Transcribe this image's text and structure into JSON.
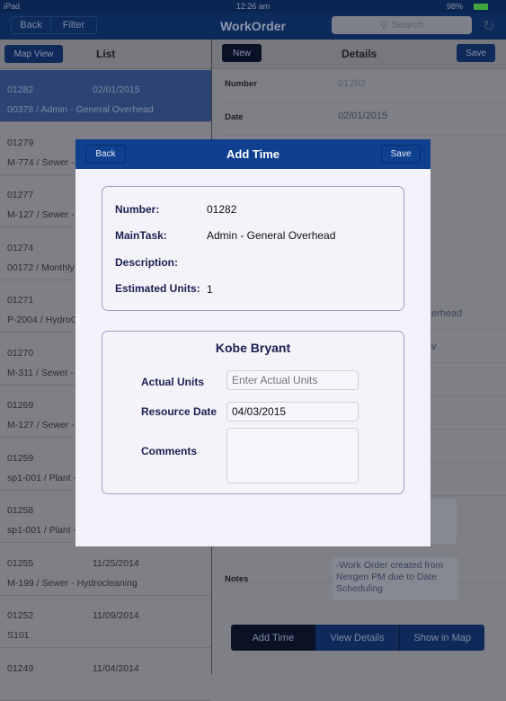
{
  "status": {
    "device": "iPad",
    "time": "12:26 am",
    "battery": "98%"
  },
  "nav": {
    "back": "Back",
    "filter": "Filter",
    "title": "WorkOrder",
    "search_placeholder": "Search"
  },
  "list_header": {
    "map_view": "Map View",
    "title": "List"
  },
  "list": [
    {
      "number": "01282",
      "date": "02/01/2015",
      "subtitle": "00378 / Admin - General Overhead",
      "selected": true
    },
    {
      "number": "01279",
      "date": "",
      "subtitle": "M-774 / Sewer -"
    },
    {
      "number": "01277",
      "date": "",
      "subtitle": "M-127 / Sewer -"
    },
    {
      "number": "01274",
      "date": "",
      "subtitle": "00172 /  Monthly"
    },
    {
      "number": "01271",
      "date": "",
      "subtitle": "P-2004 /  HydroC"
    },
    {
      "number": "01270",
      "date": "",
      "subtitle": "M-311 / Sewer -"
    },
    {
      "number": "01269",
      "date": "",
      "subtitle": "M-127 / Sewer -"
    },
    {
      "number": "01259",
      "date": "",
      "subtitle": "sp1-001 / Plant -"
    },
    {
      "number": "01258",
      "date": "",
      "subtitle": "sp1-001 / Plant -"
    },
    {
      "number": "01255",
      "date": "11/25/2014",
      "subtitle": "M-199 / Sewer - Hydrocleaning"
    },
    {
      "number": "01252",
      "date": "11/09/2014",
      "subtitle": "S101"
    },
    {
      "number": "01249",
      "date": "11/04/2014",
      "subtitle": ""
    }
  ],
  "details_header": {
    "new": "New",
    "title": "Details",
    "save": "Save"
  },
  "details": {
    "number_label": "Number",
    "number_value": "01282",
    "date_label": "Date",
    "date_value": "02/01/2015",
    "partial1": "erhead",
    "partial2": "v",
    "notes_label": "Notes",
    "notes_value": "-Work Order created from Nexgen PM due to Date Scheduling"
  },
  "segments": [
    "Add Time",
    "View Details",
    "Show in Map"
  ],
  "modal": {
    "back": "Back",
    "title": "Add Time",
    "save": "Save",
    "number_label": "Number:",
    "number_value": "01282",
    "maintask_label": "MainTask:",
    "maintask_value": "Admin - General Overhead",
    "description_label": "Description:",
    "description_value": "",
    "est_label": "Estimated Units:",
    "est_value": "1",
    "resource_name": "Kobe Bryant",
    "actual_label": "Actual Units",
    "actual_placeholder": "Enter Actual Units",
    "actual_value": "",
    "date_label": "Resource Date",
    "date_value": "04/03/2015",
    "comments_label": "Comments",
    "comments_value": ""
  },
  "colors": {
    "nav": "#0d2a5c",
    "modal_header": "#0f3f8f",
    "modal_bg": "#f3f1f9",
    "label": "#1a2050"
  }
}
